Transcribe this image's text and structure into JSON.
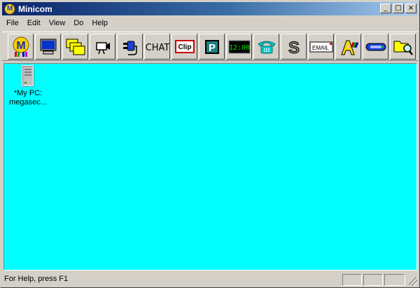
{
  "window": {
    "title": "Minicom",
    "app_icon_letter": "M",
    "minimize_label": "_",
    "maximize_label": "□",
    "close_label": "×"
  },
  "menu": [
    "File",
    "Edit",
    "View",
    "Do",
    "Help"
  ],
  "toolbar": {
    "buttons": [
      {
        "name": "minicom-logo-icon"
      },
      {
        "name": "monitor-icon"
      },
      {
        "name": "stacked-folders-icon"
      },
      {
        "name": "camera-icon"
      },
      {
        "name": "plug-icon"
      },
      {
        "name": "chat-icon",
        "text": "CHAT"
      },
      {
        "name": "clipboard-icon",
        "text": "Clip"
      },
      {
        "name": "p-icon",
        "text": "P"
      },
      {
        "name": "clock-icon",
        "text": "12:00"
      },
      {
        "name": "phone-icon"
      },
      {
        "name": "s-icon",
        "text": "S"
      },
      {
        "name": "email-icon",
        "text": "EMAIL"
      },
      {
        "name": "paint-icon"
      },
      {
        "name": "modem-icon"
      },
      {
        "name": "search-folder-icon"
      }
    ]
  },
  "content": {
    "background": "#00ffff",
    "items": [
      {
        "label_line1": "*My PC:",
        "label_line2": "megasec..."
      }
    ]
  },
  "status": {
    "text": "For Help, press F1"
  }
}
